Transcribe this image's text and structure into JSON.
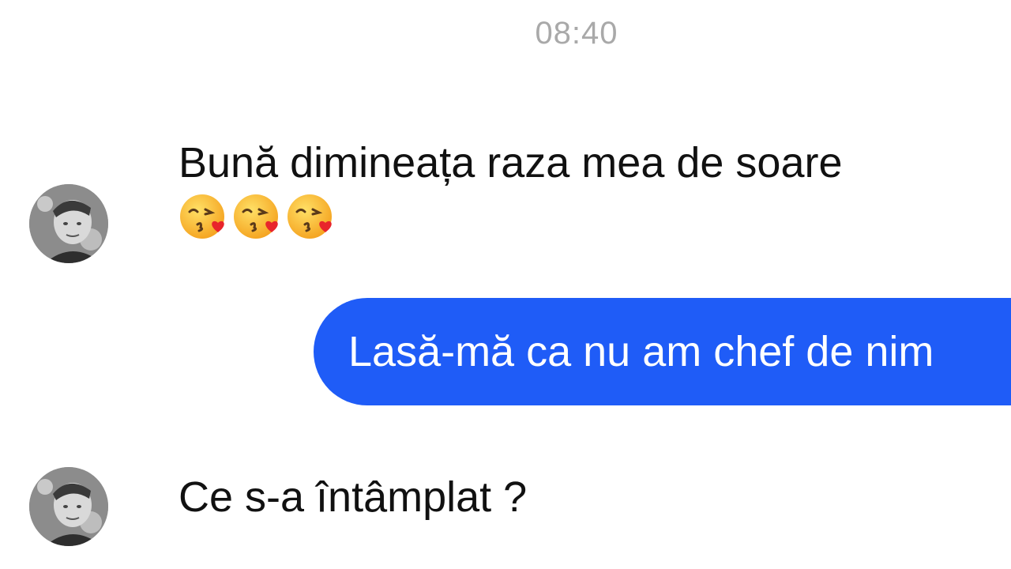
{
  "chat": {
    "timestamp": "08:40",
    "messages": [
      {
        "direction": "incoming",
        "text": "Bună dimineața raza mea de soare",
        "emoji": [
          "face-blowing-a-kiss",
          "face-blowing-a-kiss",
          "face-blowing-a-kiss"
        ]
      },
      {
        "direction": "outgoing",
        "text": "Lasă-mă ca nu am chef de nim"
      },
      {
        "direction": "incoming",
        "text": "Ce s-a întâmplat  ?"
      }
    ]
  },
  "colors": {
    "outgoing_bubble": "#1f5cf7",
    "timestamp": "#a9a9a9",
    "incoming_text": "#111111"
  }
}
